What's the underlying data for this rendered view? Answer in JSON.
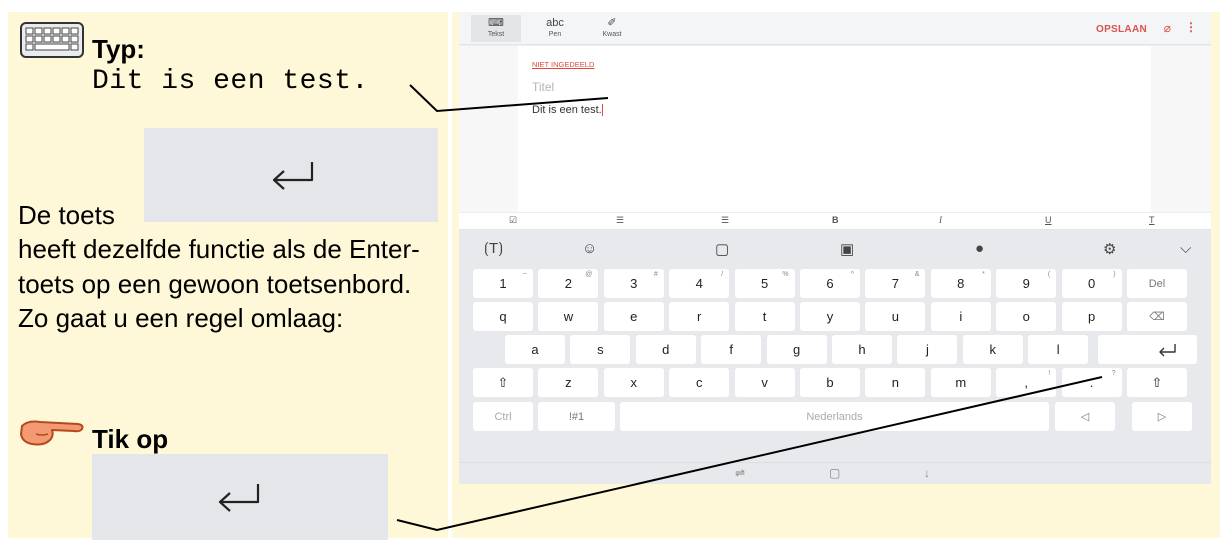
{
  "instructions": {
    "heading_type": "Typ:",
    "typed_text": "Dit is een test.",
    "key_de": "De toets",
    "paragraph": "heeft dezelfde functie als de Enter-toets op een gewoon toetsenbord. Zo gaat u een regel omlaag:",
    "heading_tap": "Tik op"
  },
  "app": {
    "tools": [
      {
        "icon": "keyboard-icon",
        "label": "Tekst"
      },
      {
        "icon": "abc",
        "label": "Pen"
      },
      {
        "icon": "brush-icon",
        "label": "Kwast"
      }
    ],
    "save_label": "OPSLAAN",
    "category": "NIET INGEDEELD",
    "title_placeholder": "Titel",
    "body_text": "Dit is een test."
  },
  "format_bar": [
    "☑",
    "☰",
    "☰",
    "B",
    "I",
    "U",
    "T"
  ],
  "keyboard": {
    "row1": [
      {
        "k": "1",
        "s": "~"
      },
      {
        "k": "2",
        "s": "@"
      },
      {
        "k": "3",
        "s": "#"
      },
      {
        "k": "4",
        "s": "/"
      },
      {
        "k": "5",
        "s": "%"
      },
      {
        "k": "6",
        "s": "^"
      },
      {
        "k": "7",
        "s": "&"
      },
      {
        "k": "8",
        "s": "*"
      },
      {
        "k": "9",
        "s": "("
      },
      {
        "k": "0",
        "s": ")"
      },
      {
        "k": "Del",
        "s": ""
      }
    ],
    "row2": [
      "q",
      "w",
      "e",
      "r",
      "t",
      "y",
      "u",
      "i",
      "o",
      "p",
      "⌫"
    ],
    "row3": [
      "a",
      "s",
      "d",
      "f",
      "g",
      "h",
      "j",
      "k",
      "l"
    ],
    "row4": [
      "⇧",
      "z",
      "x",
      "c",
      "v",
      "b",
      "n",
      "m",
      ",",
      ".",
      "⇧"
    ],
    "row4_sups": {
      "8": "!",
      "9": "?"
    },
    "ctrl": "Ctrl",
    "sym": "!#1",
    "space_label": "Nederlands"
  },
  "colors": {
    "panel_bg": "#fff8d8",
    "accent": "#e04a3a",
    "key_bg": "#ffffff",
    "keyboard_bg": "#e7e9ed"
  }
}
